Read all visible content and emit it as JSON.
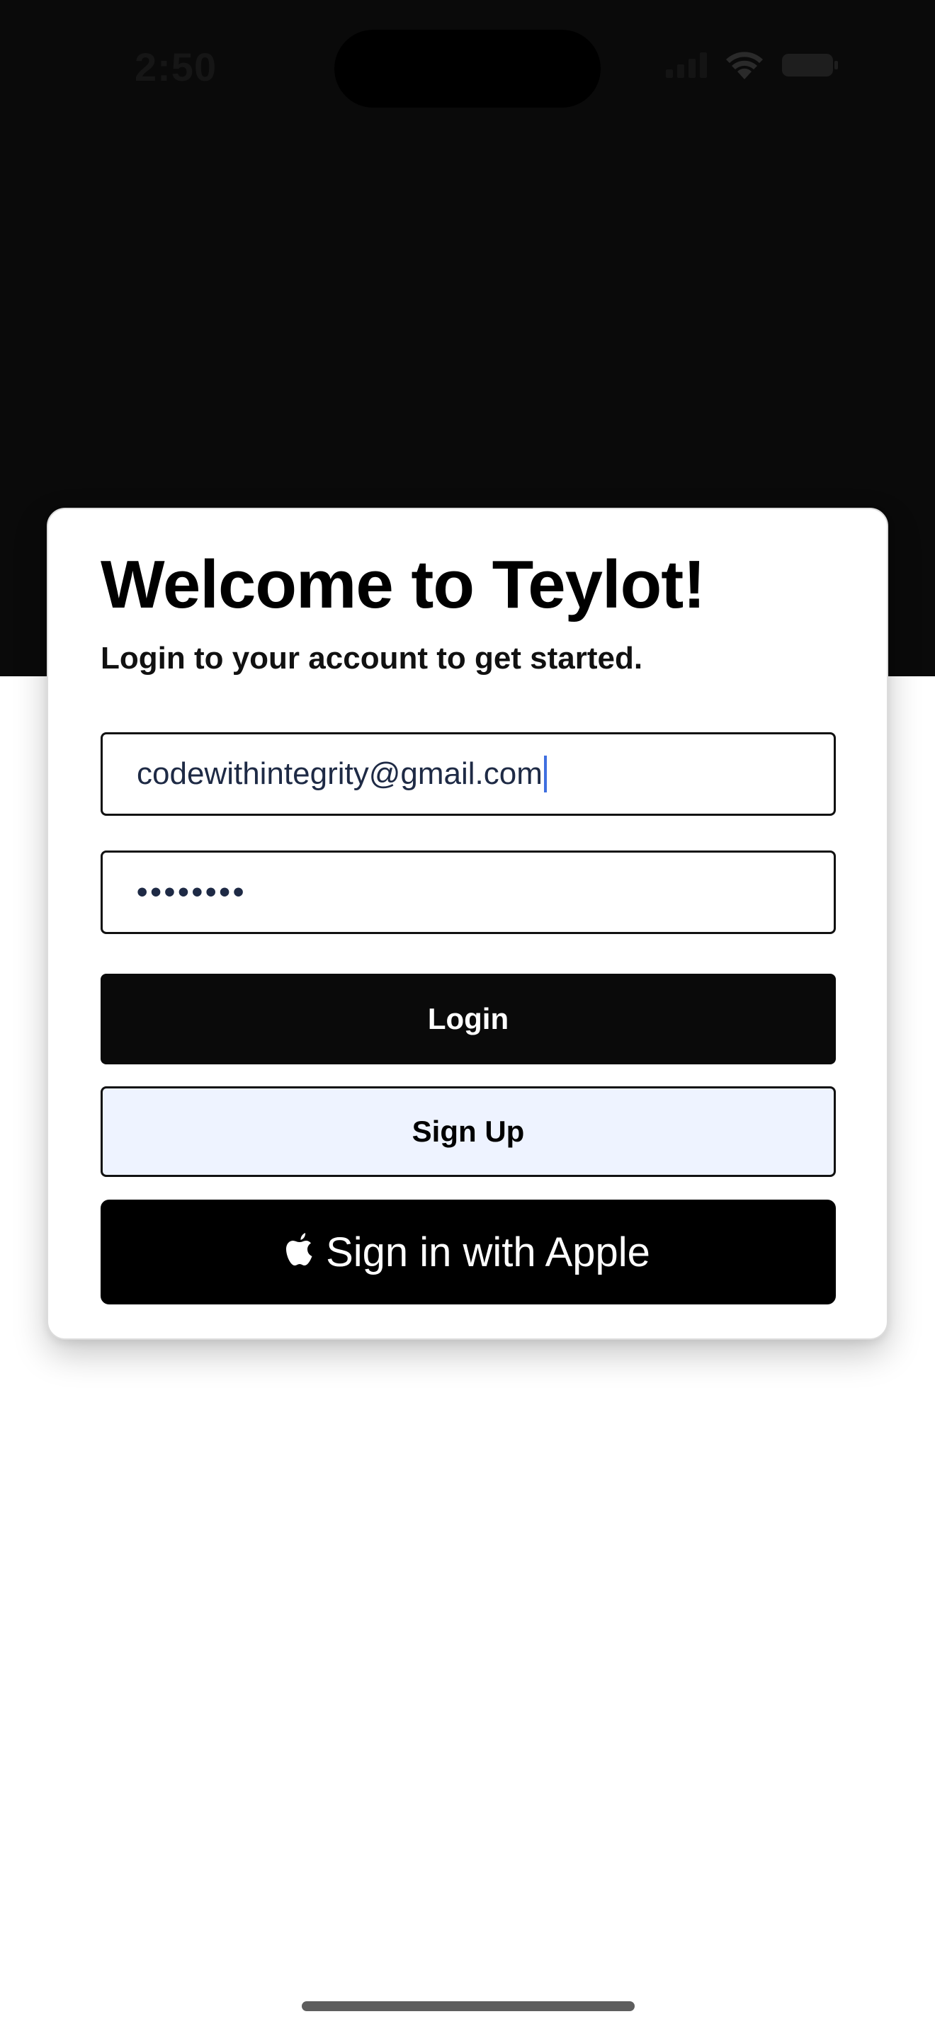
{
  "status_bar": {
    "time": "2:50"
  },
  "login_card": {
    "title": "Welcome to Teylot!",
    "subtitle": "Login to your account to get started.",
    "email_value": "codewithintegrity@gmail.com",
    "password_mask": "••••••••",
    "login_label": "Login",
    "signup_label": "Sign Up",
    "apple_label": "Sign in with Apple"
  },
  "colors": {
    "header_background": "#0a0a0a",
    "signup_background": "#eef3ff",
    "text_field_color": "#1e2a45",
    "caret_color": "#3f6fe0"
  },
  "icons": {
    "signal": "cellular-signal-icon",
    "wifi": "wifi-icon",
    "battery": "battery-icon",
    "apple": "apple-logo-icon"
  }
}
